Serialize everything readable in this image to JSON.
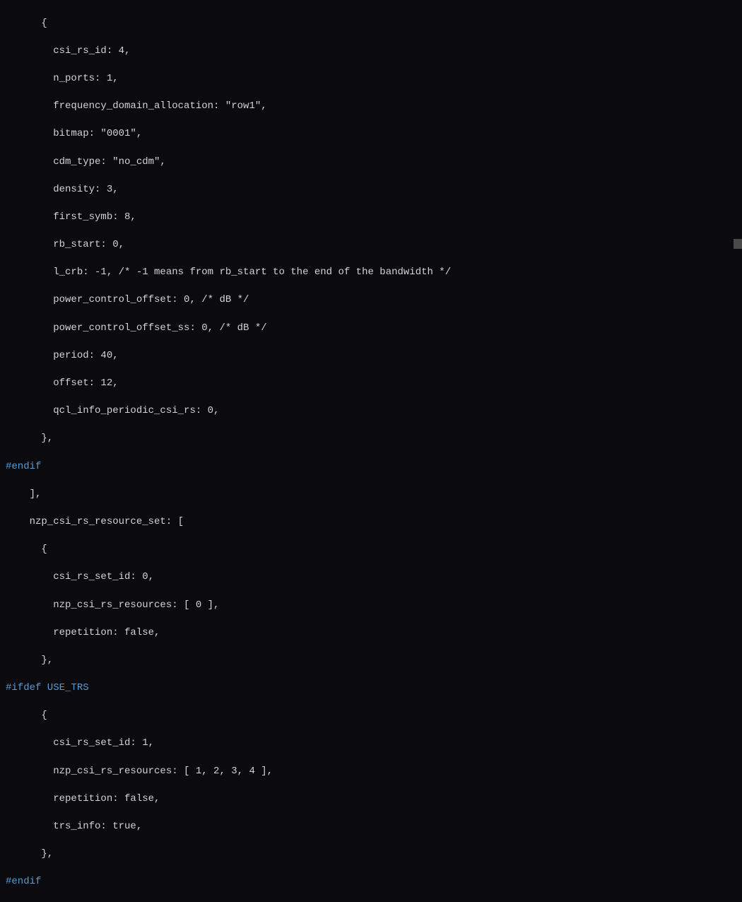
{
  "code": {
    "line1": "      {",
    "line2": "        csi_rs_id: 4,",
    "line3": "        n_ports: 1,",
    "line4": "        frequency_domain_allocation: \"row1\",",
    "line5": "        bitmap: \"0001\",",
    "line6": "        cdm_type: \"no_cdm\",",
    "line7": "        density: 3,",
    "line8": "        first_symb: 8,",
    "line9": "        rb_start: 0,",
    "line10": "        l_crb: -1, /* -1 means from rb_start to the end of the bandwidth */",
    "line11": "        power_control_offset: 0, /* dB */",
    "line12": "        power_control_offset_ss: 0, /* dB */",
    "line13": "        period: 40,",
    "line14": "        offset: 12,",
    "line15": "        qcl_info_periodic_csi_rs: 0,",
    "line16": "      },",
    "line17": "#endif",
    "line18": "    ],",
    "line19": "    nzp_csi_rs_resource_set: [",
    "line20": "      {",
    "line21": "        csi_rs_set_id: 0,",
    "line22": "        nzp_csi_rs_resources: [ 0 ],",
    "line23": "        repetition: false,",
    "line24": "      },",
    "line25": "#ifdef USE_TRS",
    "line26": "      {",
    "line27": "        csi_rs_set_id: 1,",
    "line28": "        nzp_csi_rs_resources: [ 1, 2, 3, 4 ],",
    "line29": "        repetition: false,",
    "line30": "        trs_info: true,",
    "line31": "      },",
    "line32": "#endif"
  }
}
